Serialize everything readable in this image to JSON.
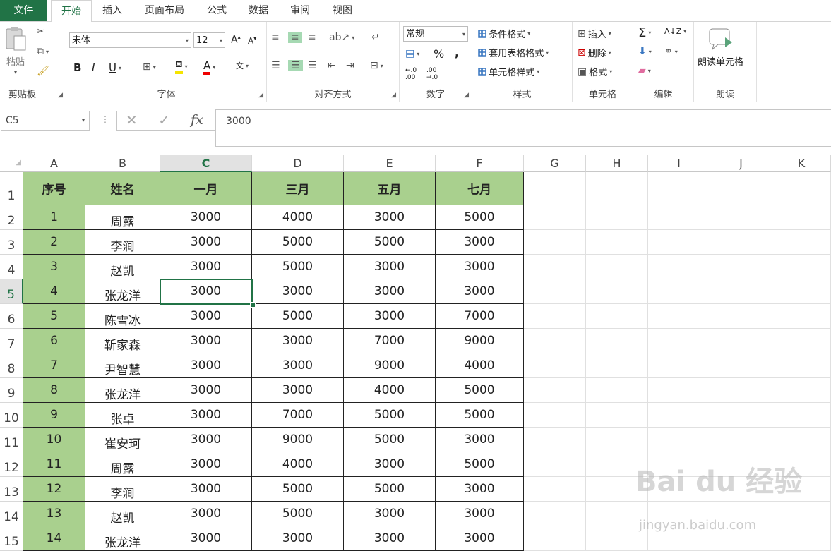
{
  "tabs": [
    "文件",
    "开始",
    "插入",
    "页面布局",
    "公式",
    "数据",
    "审阅",
    "视图"
  ],
  "ribbon": {
    "clipboard": {
      "label": "剪贴板",
      "paste": "粘贴"
    },
    "font": {
      "label": "字体",
      "name": "宋体",
      "size": "12"
    },
    "alignment": {
      "label": "对齐方式"
    },
    "number": {
      "label": "数字",
      "format": "常规"
    },
    "styles": {
      "label": "样式",
      "conditional": "条件格式",
      "table": "套用表格格式",
      "cell": "单元格样式"
    },
    "cells": {
      "label": "单元格",
      "insert": "插入",
      "delete": "删除",
      "format": "格式"
    },
    "editing": {
      "label": "编辑"
    },
    "read": {
      "label": "朗读",
      "button": "朗读单元格"
    }
  },
  "formula_bar": {
    "name_box": "C5",
    "value": "3000"
  },
  "columns": [
    "A",
    "B",
    "C",
    "D",
    "E",
    "F",
    "G",
    "H",
    "I",
    "J",
    "K"
  ],
  "table": {
    "headers": [
      "序号",
      "姓名",
      "一月",
      "三月",
      "五月",
      "七月"
    ],
    "rows": [
      [
        "1",
        "周露",
        "3000",
        "4000",
        "3000",
        "5000"
      ],
      [
        "2",
        "李涧",
        "3000",
        "5000",
        "5000",
        "3000"
      ],
      [
        "3",
        "赵凯",
        "3000",
        "5000",
        "3000",
        "3000"
      ],
      [
        "4",
        "张龙洋",
        "3000",
        "3000",
        "3000",
        "3000"
      ],
      [
        "5",
        "陈雪冰",
        "3000",
        "5000",
        "3000",
        "7000"
      ],
      [
        "6",
        "靳家森",
        "3000",
        "3000",
        "7000",
        "9000"
      ],
      [
        "7",
        "尹智慧",
        "3000",
        "3000",
        "9000",
        "4000"
      ],
      [
        "8",
        "张龙洋",
        "3000",
        "3000",
        "4000",
        "5000"
      ],
      [
        "9",
        "张卓",
        "3000",
        "7000",
        "5000",
        "5000"
      ],
      [
        "10",
        "崔安珂",
        "3000",
        "9000",
        "5000",
        "3000"
      ],
      [
        "11",
        "周露",
        "3000",
        "4000",
        "3000",
        "5000"
      ],
      [
        "12",
        "李涧",
        "3000",
        "5000",
        "5000",
        "3000"
      ],
      [
        "13",
        "赵凯",
        "3000",
        "5000",
        "3000",
        "3000"
      ],
      [
        "14",
        "张龙洋",
        "3000",
        "3000",
        "3000",
        "3000"
      ]
    ]
  },
  "row_numbers": [
    "1",
    "2",
    "3",
    "4",
    "5",
    "6",
    "7",
    "8",
    "9",
    "10",
    "11",
    "12",
    "13",
    "14",
    "15"
  ],
  "watermark": {
    "logo": "Bai du 经验",
    "url": "jingyan.baidu.com"
  },
  "colors": {
    "accent": "#217346",
    "header_fill": "#a9d08e"
  }
}
